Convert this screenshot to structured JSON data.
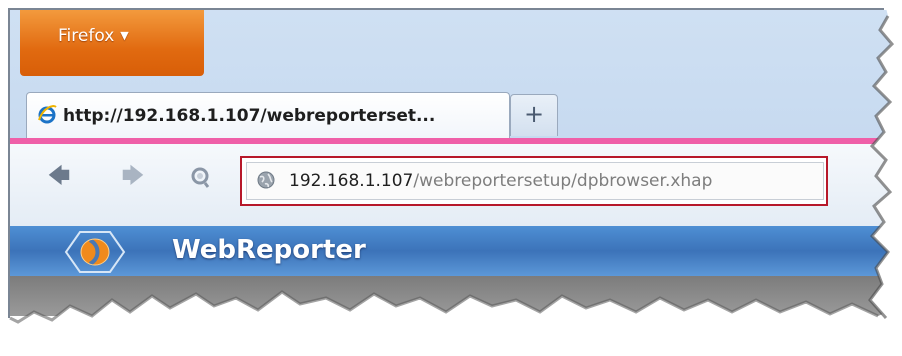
{
  "browser": {
    "menu_button_label": "Firefox",
    "active_tab_title": "http://192.168.1.107/webreporterset...",
    "new_tab_label": "+",
    "url_host": "192.168.1.107",
    "url_path": "/webreportersetup/dpbrowser.xhap"
  },
  "nav_icons": [
    "back-arrow-icon",
    "forward-arrow-icon",
    "reload-icon"
  ],
  "app": {
    "title": "WebReporter"
  },
  "colors": {
    "firefox_orange": "#e16a10",
    "tab_accent_pink": "#ef5fa8",
    "url_highlight_red": "#b7182a",
    "app_header_blue": "#3c73b9"
  }
}
